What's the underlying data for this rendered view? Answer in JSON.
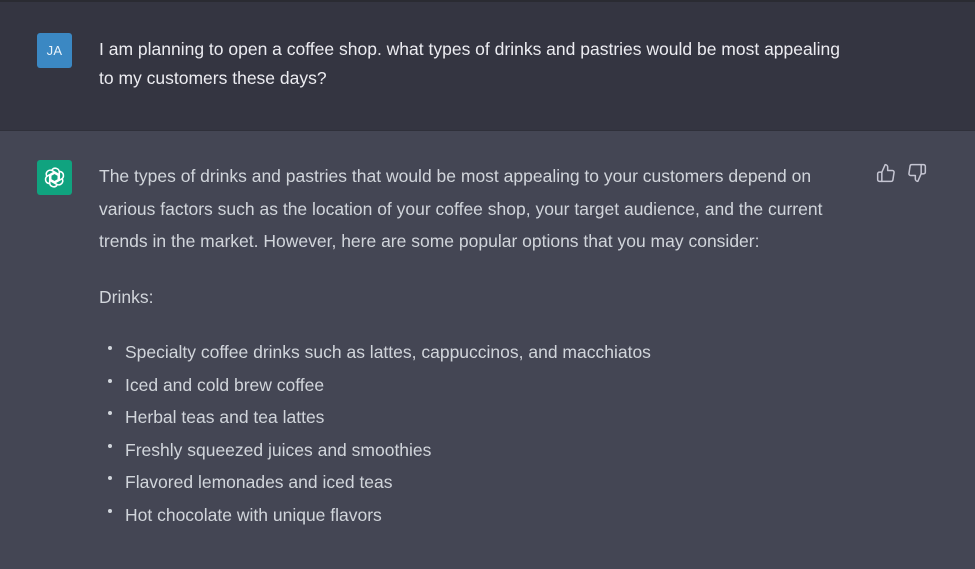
{
  "conversation": {
    "user_message": {
      "avatar_initials": "JA",
      "avatar_color": "#3b88c3",
      "text": "I am planning to open a coffee shop. what types of drinks and pastries would be most appealing to my customers these days?"
    },
    "assistant_message": {
      "avatar_icon": "openai-logo-icon",
      "avatar_color": "#10a37f",
      "intro": "The types of drinks and pastries that would be most appealing to your customers depend on various factors such as the location of your coffee shop, your target audience, and the current trends in the market. However, here are some popular options that you may consider:",
      "section_label": "Drinks:",
      "drinks": [
        "Specialty coffee drinks such as lattes, cappuccinos, and macchiatos",
        "Iced and cold brew coffee",
        "Herbal teas and tea lattes",
        "Freshly squeezed juices and smoothies",
        "Flavored lemonades and iced teas",
        "Hot chocolate with unique flavors"
      ],
      "feedback_icons": [
        "thumbs-up-icon",
        "thumbs-down-icon"
      ]
    }
  },
  "colors": {
    "user_row_bg": "#343541",
    "assistant_row_bg": "#444654",
    "text": "#d1d5db"
  }
}
